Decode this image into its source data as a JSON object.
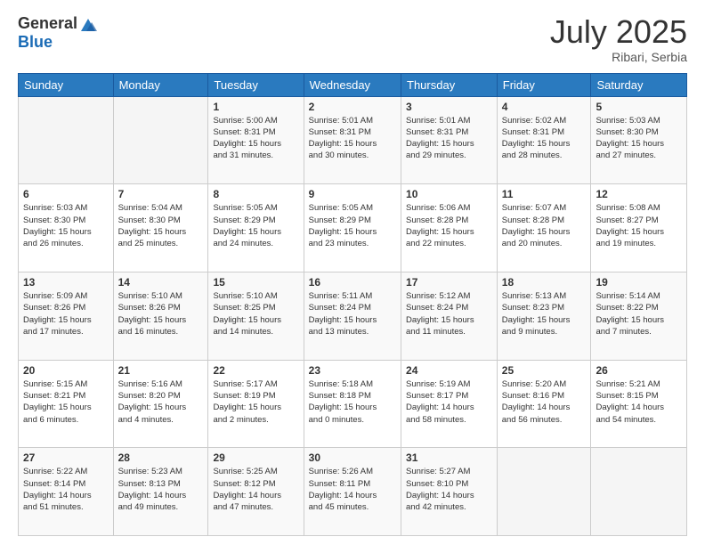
{
  "header": {
    "logo_general": "General",
    "logo_blue": "Blue",
    "month_title": "July 2025",
    "location": "Ribari, Serbia"
  },
  "days_header": [
    "Sunday",
    "Monday",
    "Tuesday",
    "Wednesday",
    "Thursday",
    "Friday",
    "Saturday"
  ],
  "weeks": [
    [
      {
        "day": "",
        "info": ""
      },
      {
        "day": "",
        "info": ""
      },
      {
        "day": "1",
        "info": "Sunrise: 5:00 AM\nSunset: 8:31 PM\nDaylight: 15 hours\nand 31 minutes."
      },
      {
        "day": "2",
        "info": "Sunrise: 5:01 AM\nSunset: 8:31 PM\nDaylight: 15 hours\nand 30 minutes."
      },
      {
        "day": "3",
        "info": "Sunrise: 5:01 AM\nSunset: 8:31 PM\nDaylight: 15 hours\nand 29 minutes."
      },
      {
        "day": "4",
        "info": "Sunrise: 5:02 AM\nSunset: 8:31 PM\nDaylight: 15 hours\nand 28 minutes."
      },
      {
        "day": "5",
        "info": "Sunrise: 5:03 AM\nSunset: 8:30 PM\nDaylight: 15 hours\nand 27 minutes."
      }
    ],
    [
      {
        "day": "6",
        "info": "Sunrise: 5:03 AM\nSunset: 8:30 PM\nDaylight: 15 hours\nand 26 minutes."
      },
      {
        "day": "7",
        "info": "Sunrise: 5:04 AM\nSunset: 8:30 PM\nDaylight: 15 hours\nand 25 minutes."
      },
      {
        "day": "8",
        "info": "Sunrise: 5:05 AM\nSunset: 8:29 PM\nDaylight: 15 hours\nand 24 minutes."
      },
      {
        "day": "9",
        "info": "Sunrise: 5:05 AM\nSunset: 8:29 PM\nDaylight: 15 hours\nand 23 minutes."
      },
      {
        "day": "10",
        "info": "Sunrise: 5:06 AM\nSunset: 8:28 PM\nDaylight: 15 hours\nand 22 minutes."
      },
      {
        "day": "11",
        "info": "Sunrise: 5:07 AM\nSunset: 8:28 PM\nDaylight: 15 hours\nand 20 minutes."
      },
      {
        "day": "12",
        "info": "Sunrise: 5:08 AM\nSunset: 8:27 PM\nDaylight: 15 hours\nand 19 minutes."
      }
    ],
    [
      {
        "day": "13",
        "info": "Sunrise: 5:09 AM\nSunset: 8:26 PM\nDaylight: 15 hours\nand 17 minutes."
      },
      {
        "day": "14",
        "info": "Sunrise: 5:10 AM\nSunset: 8:26 PM\nDaylight: 15 hours\nand 16 minutes."
      },
      {
        "day": "15",
        "info": "Sunrise: 5:10 AM\nSunset: 8:25 PM\nDaylight: 15 hours\nand 14 minutes."
      },
      {
        "day": "16",
        "info": "Sunrise: 5:11 AM\nSunset: 8:24 PM\nDaylight: 15 hours\nand 13 minutes."
      },
      {
        "day": "17",
        "info": "Sunrise: 5:12 AM\nSunset: 8:24 PM\nDaylight: 15 hours\nand 11 minutes."
      },
      {
        "day": "18",
        "info": "Sunrise: 5:13 AM\nSunset: 8:23 PM\nDaylight: 15 hours\nand 9 minutes."
      },
      {
        "day": "19",
        "info": "Sunrise: 5:14 AM\nSunset: 8:22 PM\nDaylight: 15 hours\nand 7 minutes."
      }
    ],
    [
      {
        "day": "20",
        "info": "Sunrise: 5:15 AM\nSunset: 8:21 PM\nDaylight: 15 hours\nand 6 minutes."
      },
      {
        "day": "21",
        "info": "Sunrise: 5:16 AM\nSunset: 8:20 PM\nDaylight: 15 hours\nand 4 minutes."
      },
      {
        "day": "22",
        "info": "Sunrise: 5:17 AM\nSunset: 8:19 PM\nDaylight: 15 hours\nand 2 minutes."
      },
      {
        "day": "23",
        "info": "Sunrise: 5:18 AM\nSunset: 8:18 PM\nDaylight: 15 hours\nand 0 minutes."
      },
      {
        "day": "24",
        "info": "Sunrise: 5:19 AM\nSunset: 8:17 PM\nDaylight: 14 hours\nand 58 minutes."
      },
      {
        "day": "25",
        "info": "Sunrise: 5:20 AM\nSunset: 8:16 PM\nDaylight: 14 hours\nand 56 minutes."
      },
      {
        "day": "26",
        "info": "Sunrise: 5:21 AM\nSunset: 8:15 PM\nDaylight: 14 hours\nand 54 minutes."
      }
    ],
    [
      {
        "day": "27",
        "info": "Sunrise: 5:22 AM\nSunset: 8:14 PM\nDaylight: 14 hours\nand 51 minutes."
      },
      {
        "day": "28",
        "info": "Sunrise: 5:23 AM\nSunset: 8:13 PM\nDaylight: 14 hours\nand 49 minutes."
      },
      {
        "day": "29",
        "info": "Sunrise: 5:25 AM\nSunset: 8:12 PM\nDaylight: 14 hours\nand 47 minutes."
      },
      {
        "day": "30",
        "info": "Sunrise: 5:26 AM\nSunset: 8:11 PM\nDaylight: 14 hours\nand 45 minutes."
      },
      {
        "day": "31",
        "info": "Sunrise: 5:27 AM\nSunset: 8:10 PM\nDaylight: 14 hours\nand 42 minutes."
      },
      {
        "day": "",
        "info": ""
      },
      {
        "day": "",
        "info": ""
      }
    ]
  ]
}
